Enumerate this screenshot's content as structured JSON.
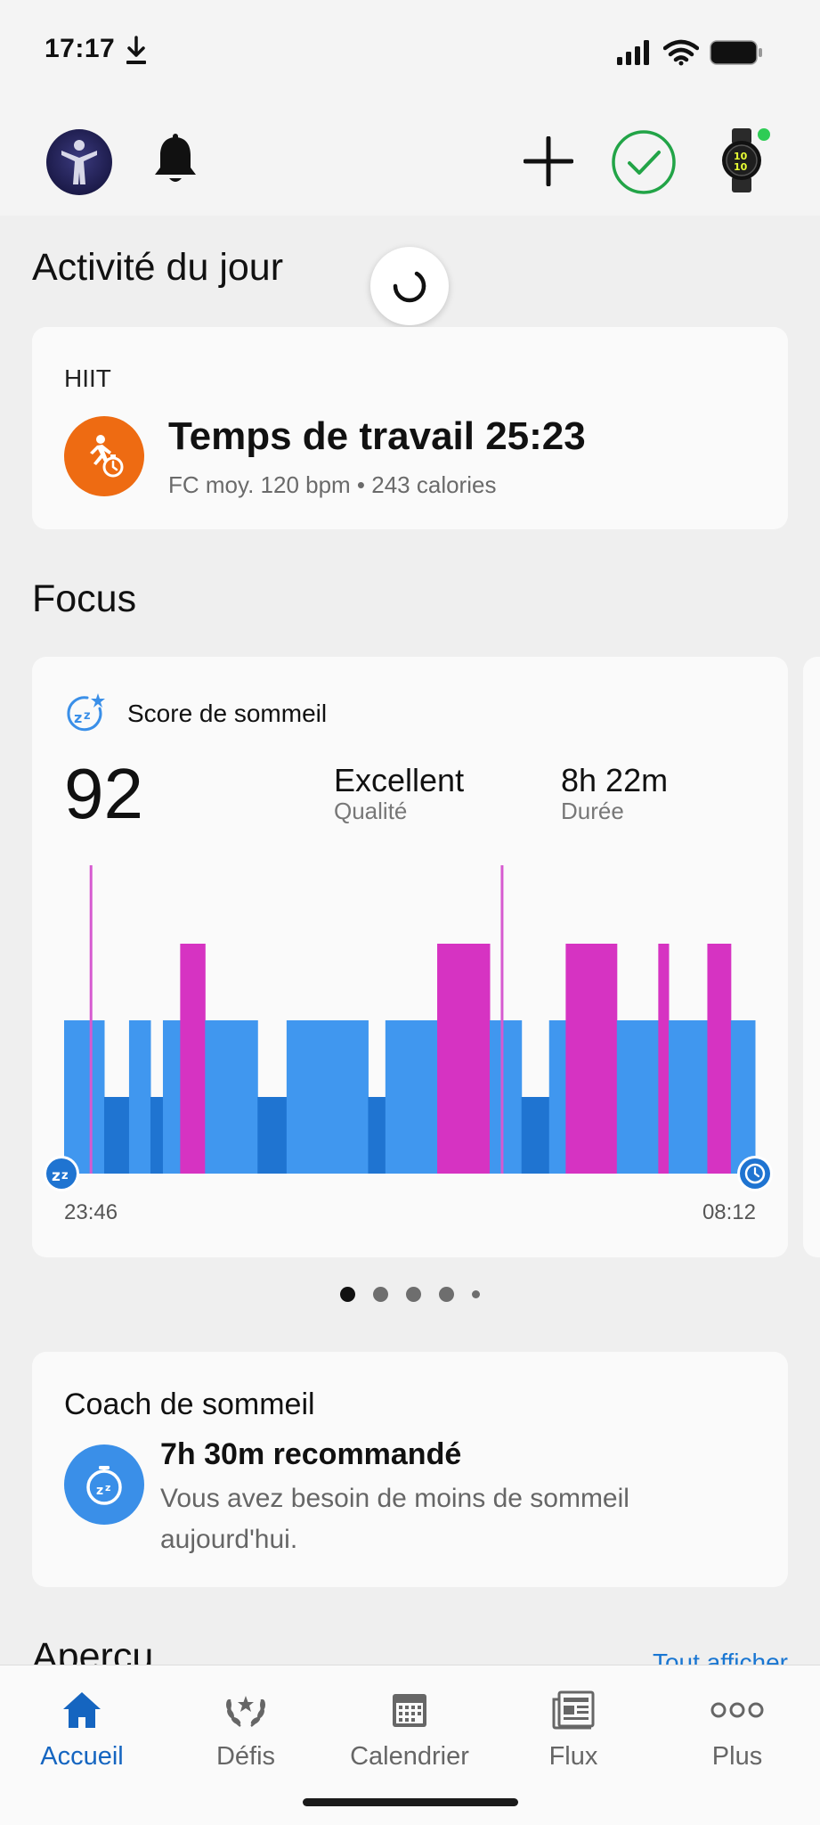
{
  "status": {
    "time": "17:17"
  },
  "page": {
    "activity_title": "Activité du jour",
    "focus_title": "Focus",
    "apercu_title": "Aperçu",
    "see_all": "Tout afficher"
  },
  "activity": {
    "type": "HIIT",
    "title": "Temps de travail 25:23",
    "subtitle": "FC moy. 120 bpm • 243 calories",
    "icon": "running-timer-icon",
    "icon_color": "#ee6b12"
  },
  "sleep": {
    "label": "Score de sommeil",
    "score": "92",
    "quality_value": "Excellent",
    "quality_label": "Qualité",
    "duration_value": "8h 22m",
    "duration_label": "Durée",
    "start_time": "23:46",
    "end_time": "08:12",
    "colors": {
      "light": "#4097ef",
      "deep": "#1f74d1",
      "rem": "#d633c2",
      "awake": "#d65ad0"
    },
    "stages_order": [
      "deep",
      "light",
      "rem",
      "awake"
    ],
    "segments": [
      {
        "stage": "light",
        "from": 0.0,
        "to": 0.058
      },
      {
        "stage": "deep",
        "from": 0.058,
        "to": 0.094
      },
      {
        "stage": "light",
        "from": 0.094,
        "to": 0.125
      },
      {
        "stage": "deep",
        "from": 0.125,
        "to": 0.143
      },
      {
        "stage": "light",
        "from": 0.143,
        "to": 0.168
      },
      {
        "stage": "rem",
        "from": 0.168,
        "to": 0.204
      },
      {
        "stage": "light",
        "from": 0.204,
        "to": 0.28
      },
      {
        "stage": "deep",
        "from": 0.28,
        "to": 0.322
      },
      {
        "stage": "light",
        "from": 0.322,
        "to": 0.44
      },
      {
        "stage": "deep",
        "from": 0.44,
        "to": 0.465
      },
      {
        "stage": "light",
        "from": 0.465,
        "to": 0.54
      },
      {
        "stage": "rem",
        "from": 0.54,
        "to": 0.616
      },
      {
        "stage": "light",
        "from": 0.616,
        "to": 0.662
      },
      {
        "stage": "deep",
        "from": 0.662,
        "to": 0.702
      },
      {
        "stage": "light",
        "from": 0.702,
        "to": 0.726
      },
      {
        "stage": "rem",
        "from": 0.726,
        "to": 0.8
      },
      {
        "stage": "light",
        "from": 0.8,
        "to": 0.86
      },
      {
        "stage": "rem",
        "from": 0.86,
        "to": 0.875
      },
      {
        "stage": "light",
        "from": 0.875,
        "to": 0.931
      },
      {
        "stage": "rem",
        "from": 0.931,
        "to": 0.965
      },
      {
        "stage": "light",
        "from": 0.965,
        "to": 1.0
      }
    ],
    "awake_marks": [
      0.037,
      0.632
    ]
  },
  "carousel": {
    "pages": 5,
    "active_index": 0
  },
  "coach": {
    "title": "Coach de sommeil",
    "headline": "7h 30m recommandé",
    "text": "Vous avez besoin de moins de sommeil aujourd'hui."
  },
  "tabs": [
    {
      "label": "Accueil",
      "icon": "home-icon",
      "active": true
    },
    {
      "label": "Défis",
      "icon": "laurel-icon",
      "active": false
    },
    {
      "label": "Calendrier",
      "icon": "calendar-icon",
      "active": false
    },
    {
      "label": "Flux",
      "icon": "news-feed-icon",
      "active": false
    },
    {
      "label": "Plus",
      "icon": "more-dots-icon",
      "active": false
    }
  ],
  "accent_color": "#1565c0"
}
